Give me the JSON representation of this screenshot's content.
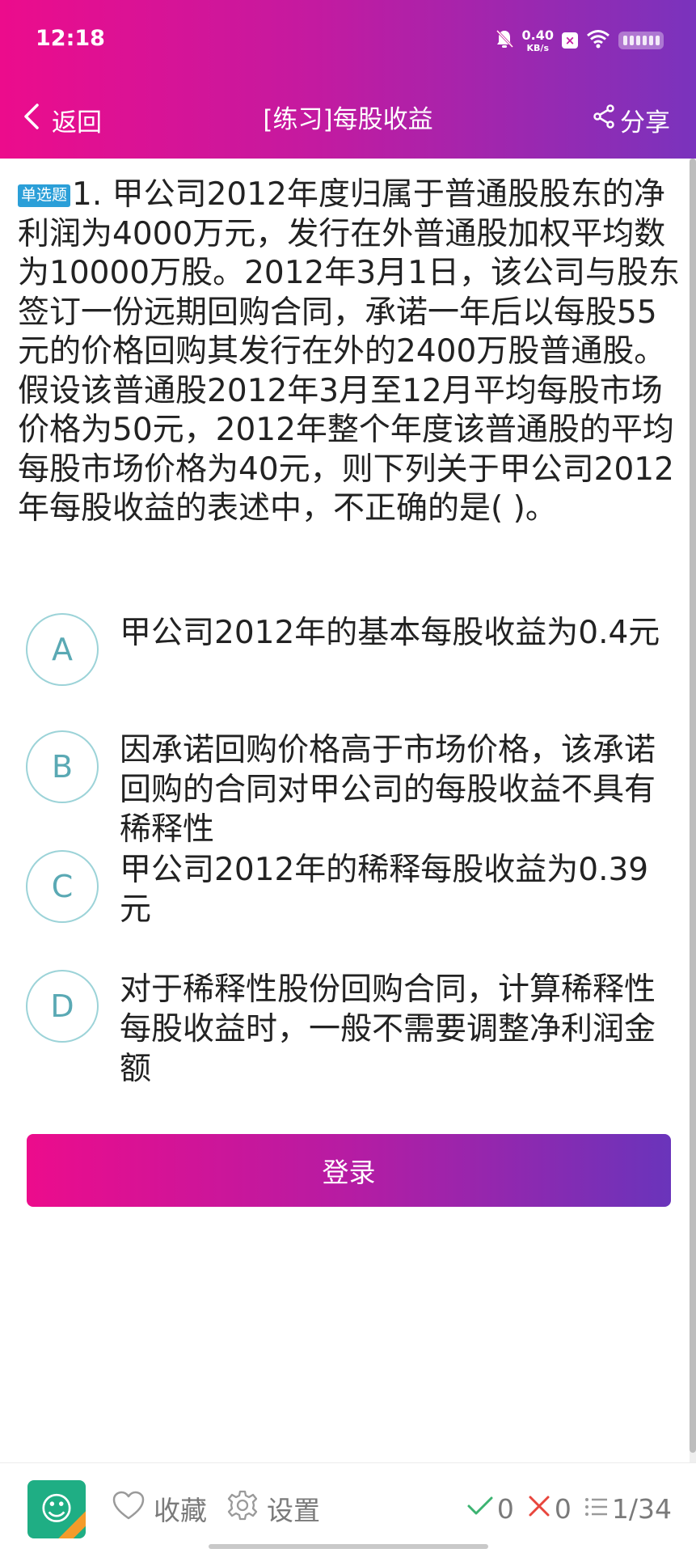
{
  "status_bar": {
    "time": "12:18",
    "net_speed_value": "0.40",
    "net_speed_unit": "KB/s",
    "icons": [
      "bell-muted-icon",
      "close-box-icon",
      "wifi-icon",
      "battery-icon"
    ]
  },
  "header": {
    "back_label": "返回",
    "title": "[练习]每股收益",
    "share_label": "分享"
  },
  "question": {
    "type_tag": "单选题",
    "text": "1. 甲公司2012年度归属于普通股股东的净利润为4000万元，发行在外普通股加权平均数为10000万股。2012年3月1日，该公司与股东签订一份远期回购合同，承诺一年后以每股55元的价格回购其发行在外的2400万股普通股。假设该普通股2012年3月至12月平均每股市场价格为50元，2012年整个年度该普通股的平均每股市场价格为40元，则下列关于甲公司2012年每股收益的表述中，不正确的是( )。"
  },
  "options": [
    {
      "letter": "A",
      "text": "甲公司2012年的基本每股收益为0.4元"
    },
    {
      "letter": "B",
      "text": "因承诺回购价格高于市场价格，该承诺回购的合同对甲公司的每股收益不具有稀释性"
    },
    {
      "letter": "C",
      "text": "甲公司2012年的稀释每股收益为0.39元"
    },
    {
      "letter": "D",
      "text": "对于稀释性股份回购合同，计算稀释性每股收益时，一般不需要调整净利润金额"
    }
  ],
  "login_label": "登录",
  "bottom_bar": {
    "favorite_label": "收藏",
    "settings_label": "设置",
    "correct_count": "0",
    "wrong_count": "0",
    "progress": "1/34"
  },
  "colors": {
    "header_start": "#ec0c8c",
    "header_end": "#7a33bd",
    "tag_blue": "#2b9fd8",
    "option_circle": "#9cd3d8",
    "correct_green": "#3cb371",
    "wrong_red": "#e8463d"
  }
}
